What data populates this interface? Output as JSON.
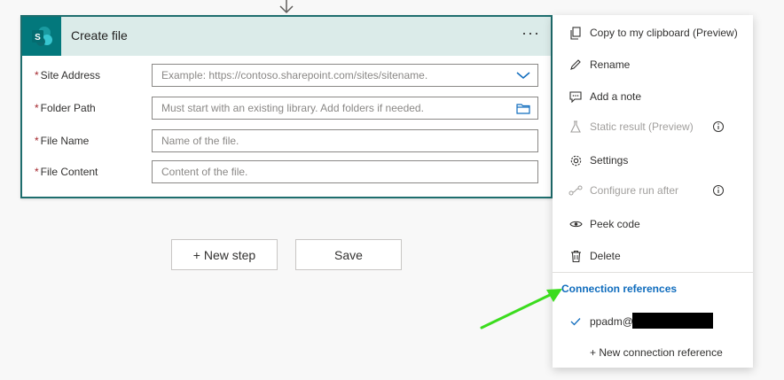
{
  "card": {
    "title": "Create file",
    "more_label": "···",
    "fields": [
      {
        "required": "*",
        "label": "Site Address",
        "placeholder": "Example: https://contoso.sharepoint.com/sites/sitename.",
        "trailing_icon": "chevron-down-icon"
      },
      {
        "required": "*",
        "label": "Folder Path",
        "placeholder": "Must start with an existing library. Add folders if needed.",
        "trailing_icon": "folder-icon"
      },
      {
        "required": "*",
        "label": "File Name",
        "placeholder": "Name of the file."
      },
      {
        "required": "*",
        "label": "File Content",
        "placeholder": "Content of the file."
      }
    ]
  },
  "buttons": {
    "new_step": "+ New step",
    "save": "Save"
  },
  "menu": {
    "items": [
      {
        "label": "Copy to my clipboard (Preview)",
        "icon": "copy-icon",
        "disabled": false
      },
      {
        "label": "Rename",
        "icon": "pencil-icon",
        "disabled": false
      },
      {
        "label": "Add a note",
        "icon": "note-icon",
        "disabled": false
      },
      {
        "label": "Static result (Preview)",
        "icon": "flask-icon",
        "disabled": true,
        "info": true
      },
      {
        "label": "Settings",
        "icon": "gear-icon",
        "disabled": false
      },
      {
        "label": "Configure run after",
        "icon": "run-after-icon",
        "disabled": true,
        "info": true
      },
      {
        "label": "Peek code",
        "icon": "eye-icon",
        "disabled": false
      },
      {
        "label": "Delete",
        "icon": "trash-icon",
        "disabled": false
      }
    ],
    "section_title": "Connection references",
    "connection": {
      "label": "ppadm@",
      "selected": true
    },
    "new_connection": "+ New connection reference"
  },
  "colors": {
    "accent": "#0f6cbd",
    "header_bg": "#dbebe9",
    "sharepoint": "#03787c",
    "annotation_arrow": "#3bdc1e"
  }
}
